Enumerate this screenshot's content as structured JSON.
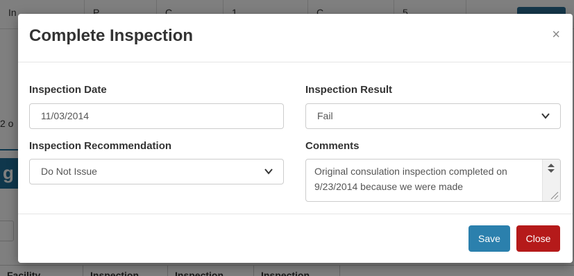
{
  "background": {
    "top_row": [
      "In",
      "P",
      "C",
      "1",
      "C",
      "5"
    ],
    "side_text": "2 o",
    "blue_bar_letter": "g",
    "table_headers": [
      "Facility",
      "Inspection",
      "Inspection",
      "Inspection"
    ]
  },
  "modal": {
    "title": "Complete Inspection",
    "close_icon": "×",
    "fields": {
      "inspection_date": {
        "label": "Inspection Date",
        "value": "11/03/2014"
      },
      "inspection_result": {
        "label": "Inspection Result",
        "value": "Fail"
      },
      "inspection_recommendation": {
        "label": "Inspection Recommendation",
        "value": "Do Not Issue"
      },
      "comments": {
        "label": "Comments",
        "value": "Original consulation inspection completed on 9/23/2014 because we were made"
      }
    },
    "buttons": {
      "save": "Save",
      "close": "Close"
    }
  },
  "colors": {
    "save": "#2b80ad",
    "close": "#b51a1a",
    "accent": "#1e6f98"
  }
}
